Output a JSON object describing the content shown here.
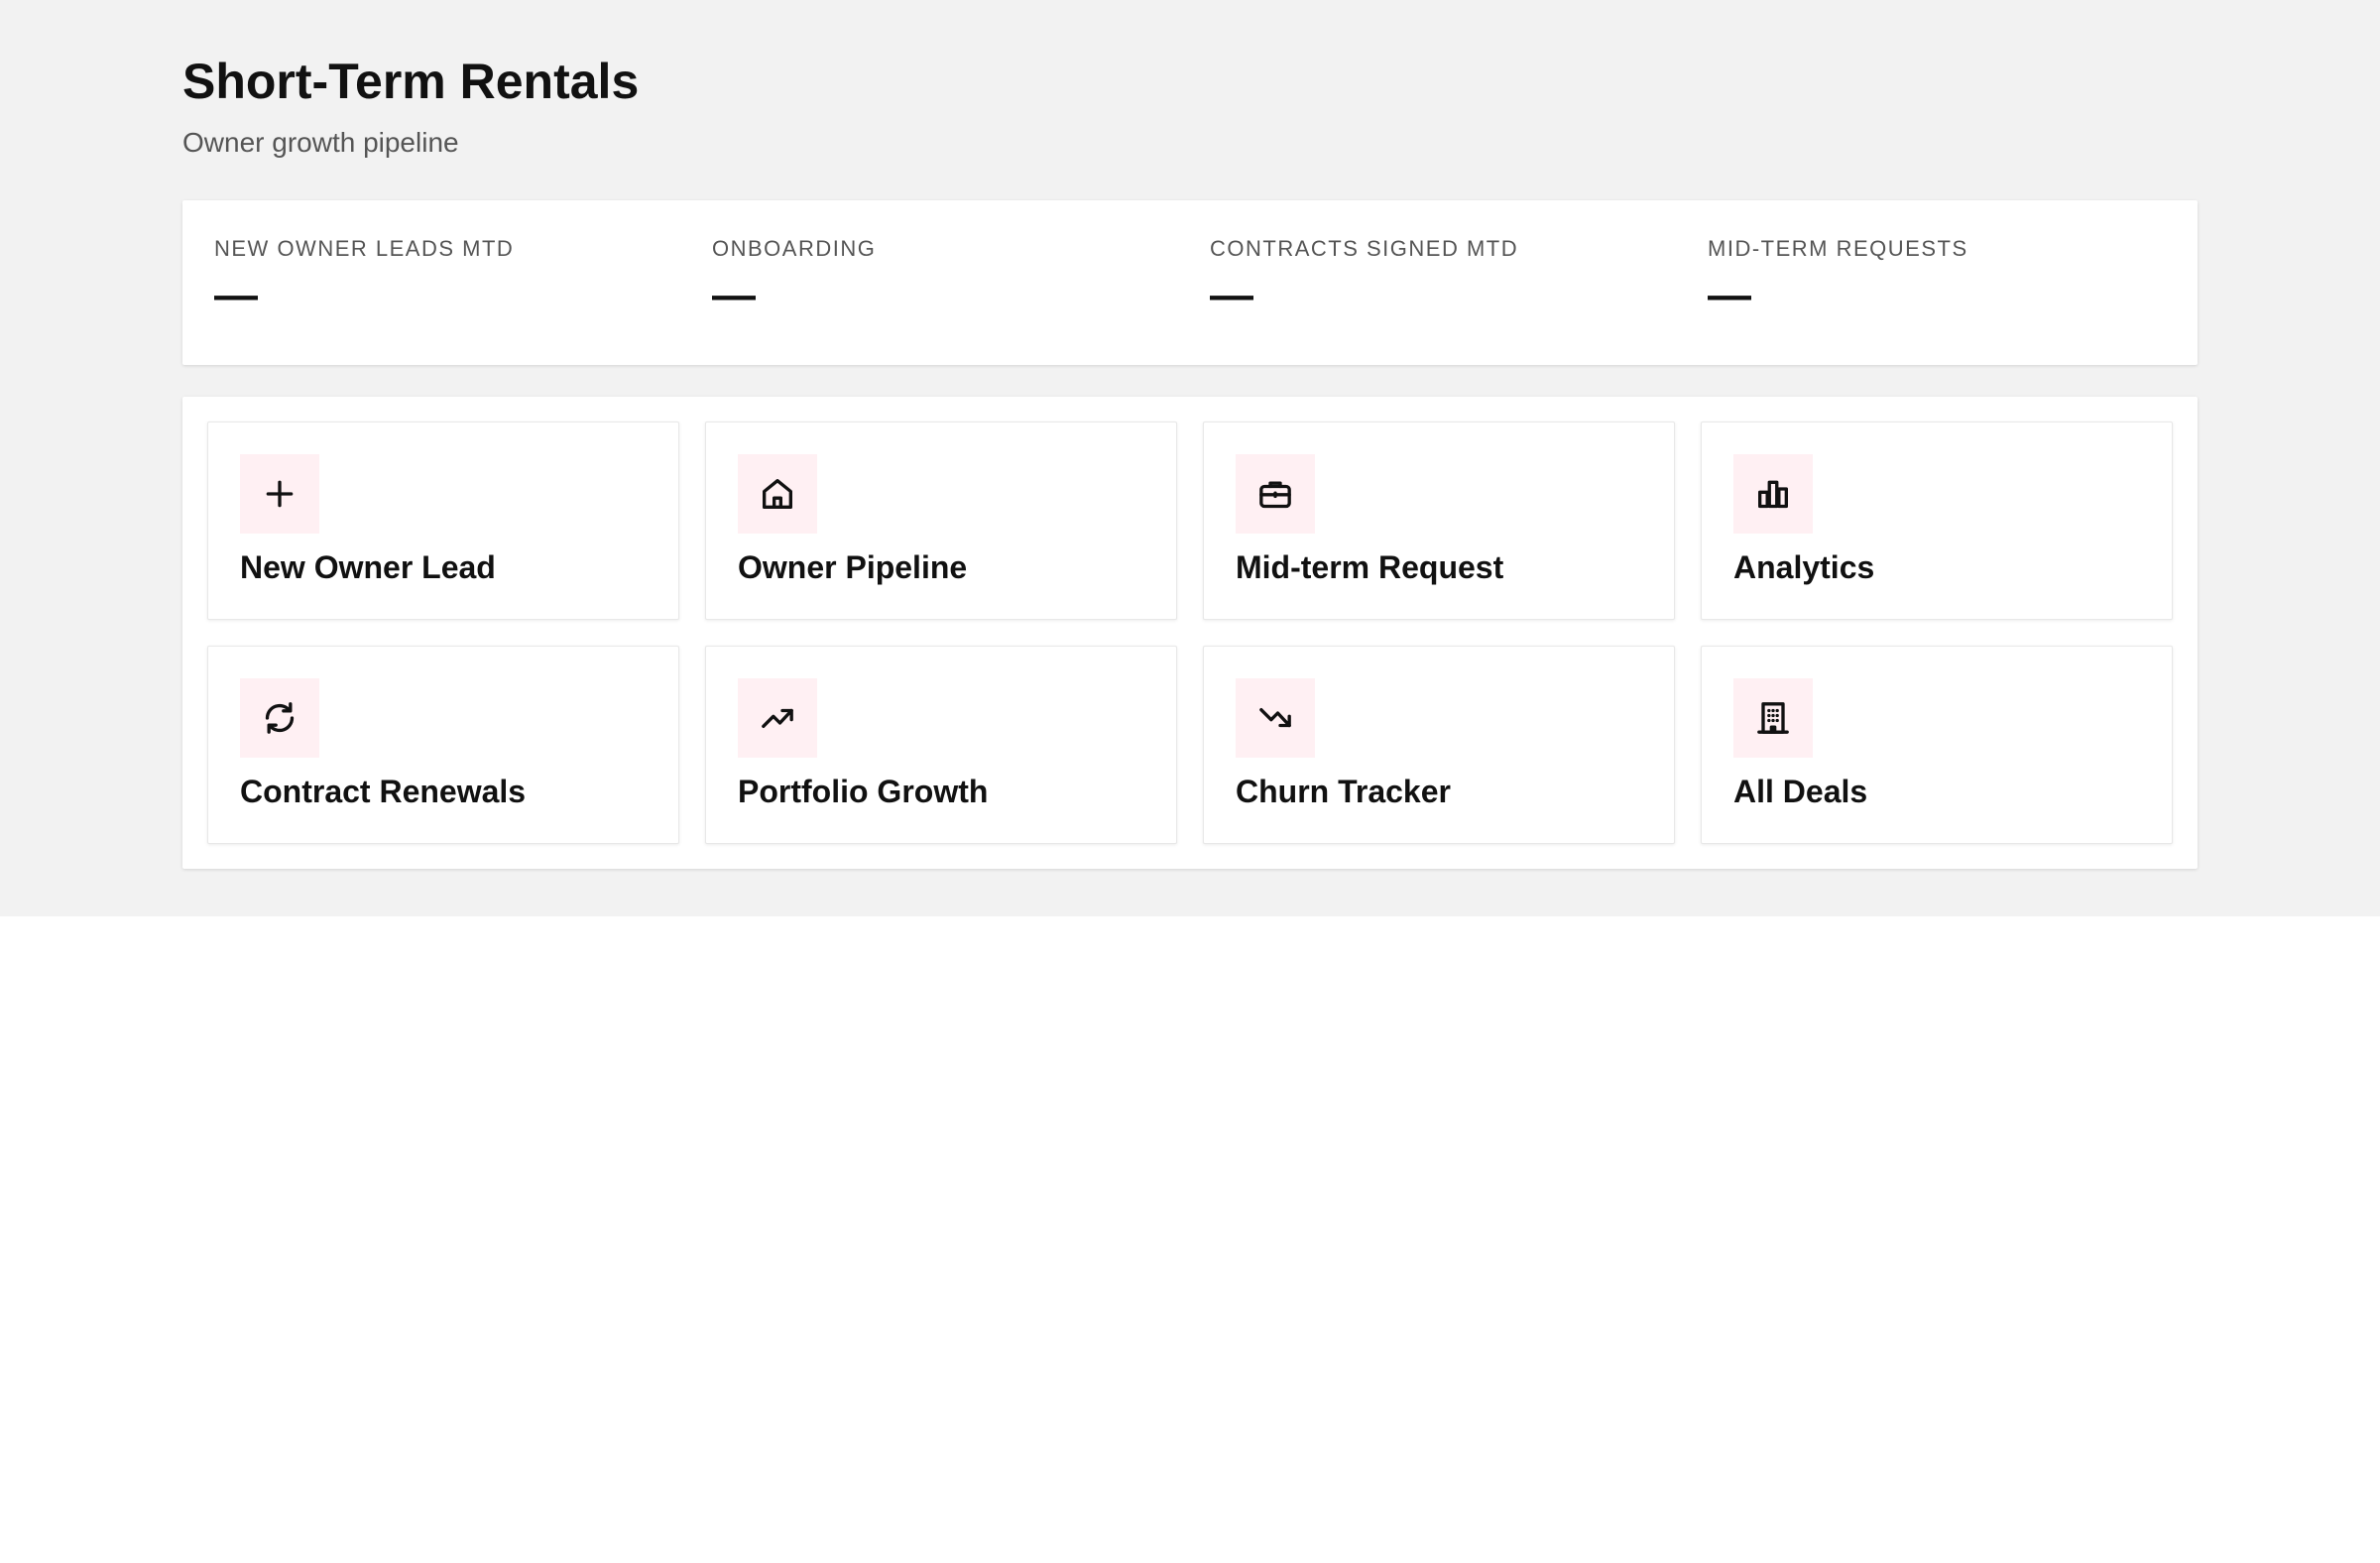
{
  "header": {
    "title": "Short-Term Rentals",
    "subtitle": "Owner growth pipeline"
  },
  "stats": [
    {
      "label": "NEW OWNER LEADS MTD",
      "value": "—"
    },
    {
      "label": "ONBOARDING",
      "value": "—"
    },
    {
      "label": "CONTRACTS SIGNED MTD",
      "value": "—"
    },
    {
      "label": "MID-TERM REQUESTS",
      "value": "—"
    }
  ],
  "actions": [
    {
      "label": "New Owner Lead",
      "icon": "plus-icon"
    },
    {
      "label": "Owner Pipeline",
      "icon": "home-icon"
    },
    {
      "label": "Mid-term Request",
      "icon": "briefcase-icon"
    },
    {
      "label": "Analytics",
      "icon": "bar-chart-icon"
    },
    {
      "label": "Contract Renewals",
      "icon": "refresh-icon"
    },
    {
      "label": "Portfolio Growth",
      "icon": "trending-up-icon"
    },
    {
      "label": "Churn Tracker",
      "icon": "trending-down-icon"
    },
    {
      "label": "All Deals",
      "icon": "building-icon"
    }
  ],
  "colors": {
    "page_background": "#f2f2f2",
    "icon_tile_background": "#fff0f3",
    "text_primary": "#111111",
    "text_secondary": "#555555"
  }
}
